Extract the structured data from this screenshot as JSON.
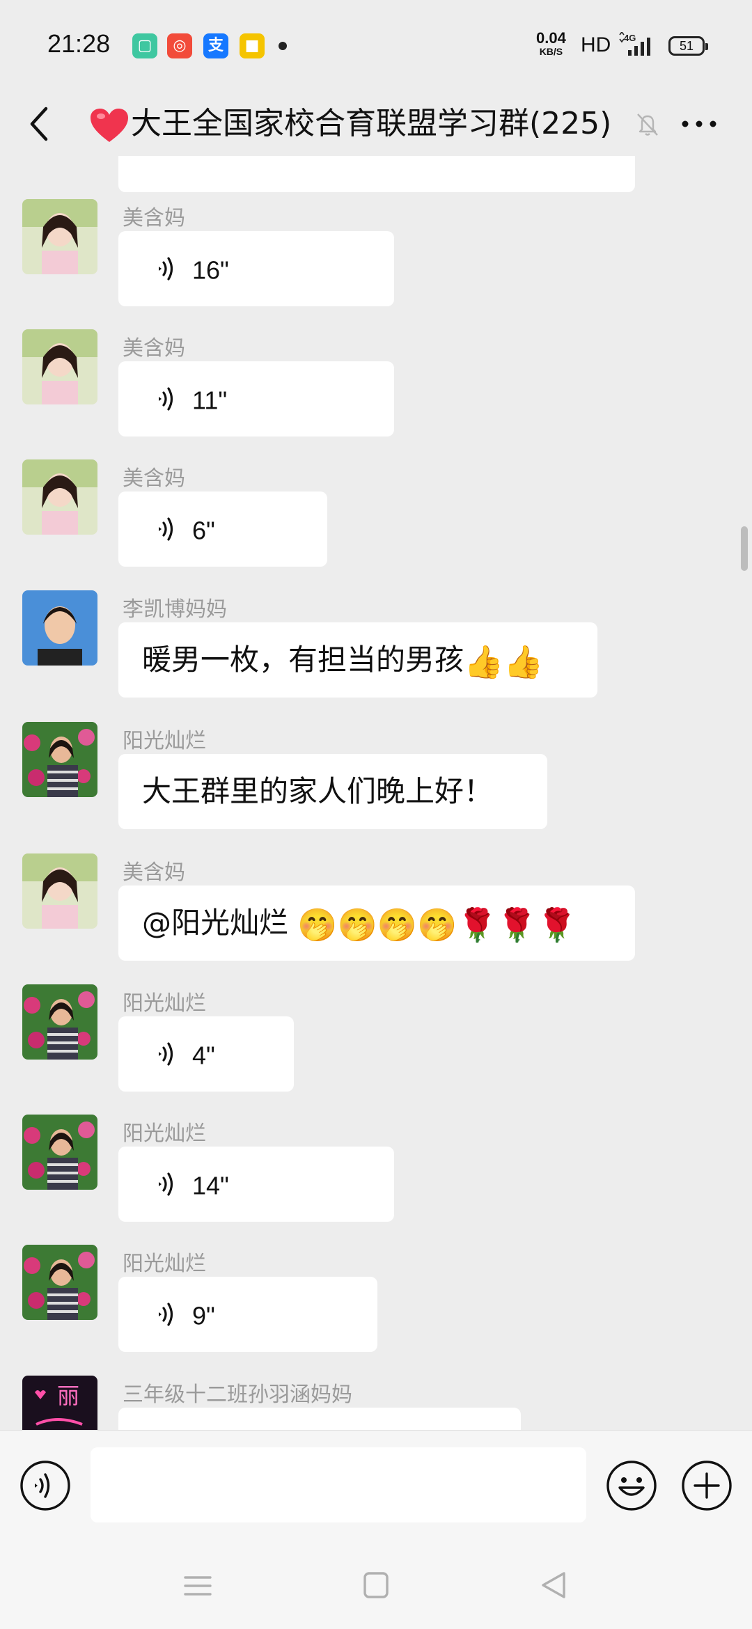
{
  "status_bar": {
    "time": "21:28",
    "app_icons": [
      {
        "name": "green-app-icon",
        "color": "#3fc7a0"
      },
      {
        "name": "kuaishou-icon",
        "color": "#f24b3a"
      },
      {
        "name": "alipay-icon",
        "color": "#1678ff"
      },
      {
        "name": "yellow-app-icon",
        "color": "#f5c400"
      }
    ],
    "net_speed": "0.04",
    "net_unit": "KB/S",
    "hd": "HD",
    "network": "4G",
    "battery": "51"
  },
  "header": {
    "title": "大王全国家校合育联盟学习群(225)",
    "heart_color": "#f0344e"
  },
  "messages": [
    {
      "sender": "美含妈",
      "avatar": "meihanma",
      "type": "voice",
      "duration": "16\""
    },
    {
      "sender": "美含妈",
      "avatar": "meihanma",
      "type": "voice",
      "duration": "11\""
    },
    {
      "sender": "美含妈",
      "avatar": "meihanma",
      "type": "voice",
      "duration": "6\""
    },
    {
      "sender": "李凯博妈妈",
      "avatar": "likaibo",
      "type": "text",
      "text": "暖男一枚，有担当的男孩",
      "emoji": "👍👍"
    },
    {
      "sender": "阳光灿烂",
      "avatar": "yangguang",
      "type": "text",
      "text": "大王群里的家人们晚上好！"
    },
    {
      "sender": "美含妈",
      "avatar": "meihanma",
      "type": "text",
      "text": "@阳光灿烂 ",
      "emoji": "🤭🤭🤭🤭🌹🌹🌹"
    },
    {
      "sender": "阳光灿烂",
      "avatar": "yangguang",
      "type": "voice",
      "duration": "4\""
    },
    {
      "sender": "阳光灿烂",
      "avatar": "yangguang",
      "type": "voice",
      "duration": "14\""
    },
    {
      "sender": "阳光灿烂",
      "avatar": "yangguang",
      "type": "voice",
      "duration": "9\""
    },
    {
      "sender": "三年级十二班孙羽涵妈妈",
      "avatar": "sunyuhan",
      "avatar_text": "丽",
      "type": "text",
      "text": "",
      "emoji": "😊😊😊"
    }
  ],
  "input": {
    "placeholder": "",
    "value": ""
  },
  "colors": {
    "background": "#ededed",
    "bubble": "#ffffff",
    "sender_name": "#9a9a9a"
  }
}
